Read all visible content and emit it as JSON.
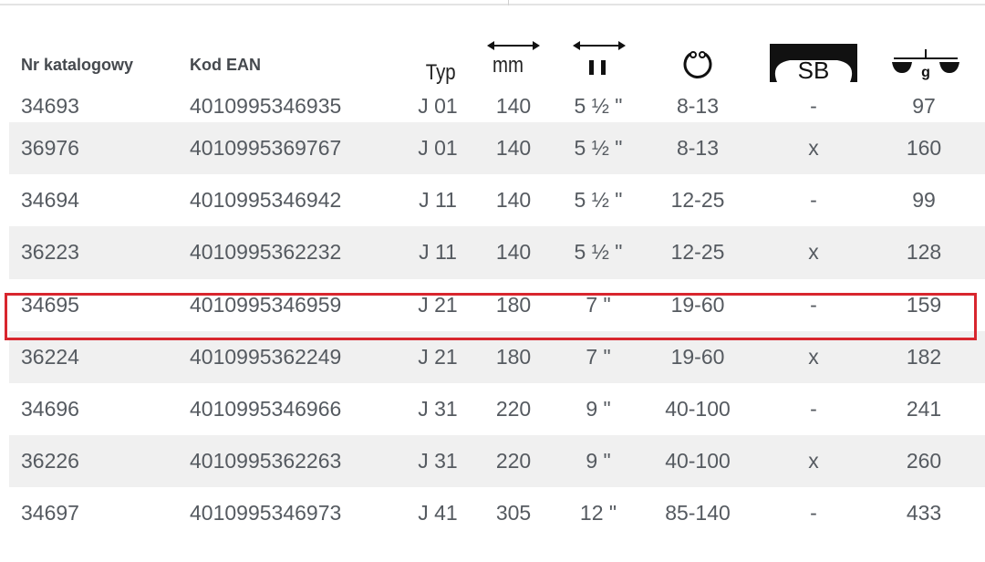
{
  "headers": {
    "nr": "Nr katalogowy",
    "ean": "Kod EAN",
    "typ": "Typ",
    "mm": "mm",
    "sb": "SB",
    "g": "g"
  },
  "icons": {
    "length": "double-arrow-icon",
    "inch": "inch-width-icon",
    "range": "circle-clamp-icon",
    "sb": "sb-package-icon",
    "weight": "scale-icon"
  },
  "rows": [
    {
      "nr": "34693",
      "ean": "4010995346935",
      "typ": "J 01",
      "mm": "140",
      "inch": "5 ½ \"",
      "range": "8-13",
      "sb": "-",
      "g": "97"
    },
    {
      "nr": "36976",
      "ean": "4010995369767",
      "typ": "J 01",
      "mm": "140",
      "inch": "5 ½ \"",
      "range": "8-13",
      "sb": "x",
      "g": "160"
    },
    {
      "nr": "34694",
      "ean": "4010995346942",
      "typ": "J 11",
      "mm": "140",
      "inch": "5 ½ \"",
      "range": "12-25",
      "sb": "-",
      "g": "99"
    },
    {
      "nr": "36223",
      "ean": "4010995362232",
      "typ": "J 11",
      "mm": "140",
      "inch": "5 ½ \"",
      "range": "12-25",
      "sb": "x",
      "g": "128"
    },
    {
      "nr": "34695",
      "ean": "4010995346959",
      "typ": "J 21",
      "mm": "180",
      "inch": "7 \"",
      "range": "19-60",
      "sb": "-",
      "g": "159"
    },
    {
      "nr": "36224",
      "ean": "4010995362249",
      "typ": "J 21",
      "mm": "180",
      "inch": "7 \"",
      "range": "19-60",
      "sb": "x",
      "g": "182"
    },
    {
      "nr": "34696",
      "ean": "4010995346966",
      "typ": "J 31",
      "mm": "220",
      "inch": "9 \"",
      "range": "40-100",
      "sb": "-",
      "g": "241"
    },
    {
      "nr": "36226",
      "ean": "4010995362263",
      "typ": "J 31",
      "mm": "220",
      "inch": "9 \"",
      "range": "40-100",
      "sb": "x",
      "g": "260"
    },
    {
      "nr": "34697",
      "ean": "4010995346973",
      "typ": "J 41",
      "mm": "305",
      "inch": "12 \"",
      "range": "85-140",
      "sb": "-",
      "g": "433"
    }
  ],
  "highlight_color": "#d8262e",
  "alt_row_color": "#f0f0f0"
}
